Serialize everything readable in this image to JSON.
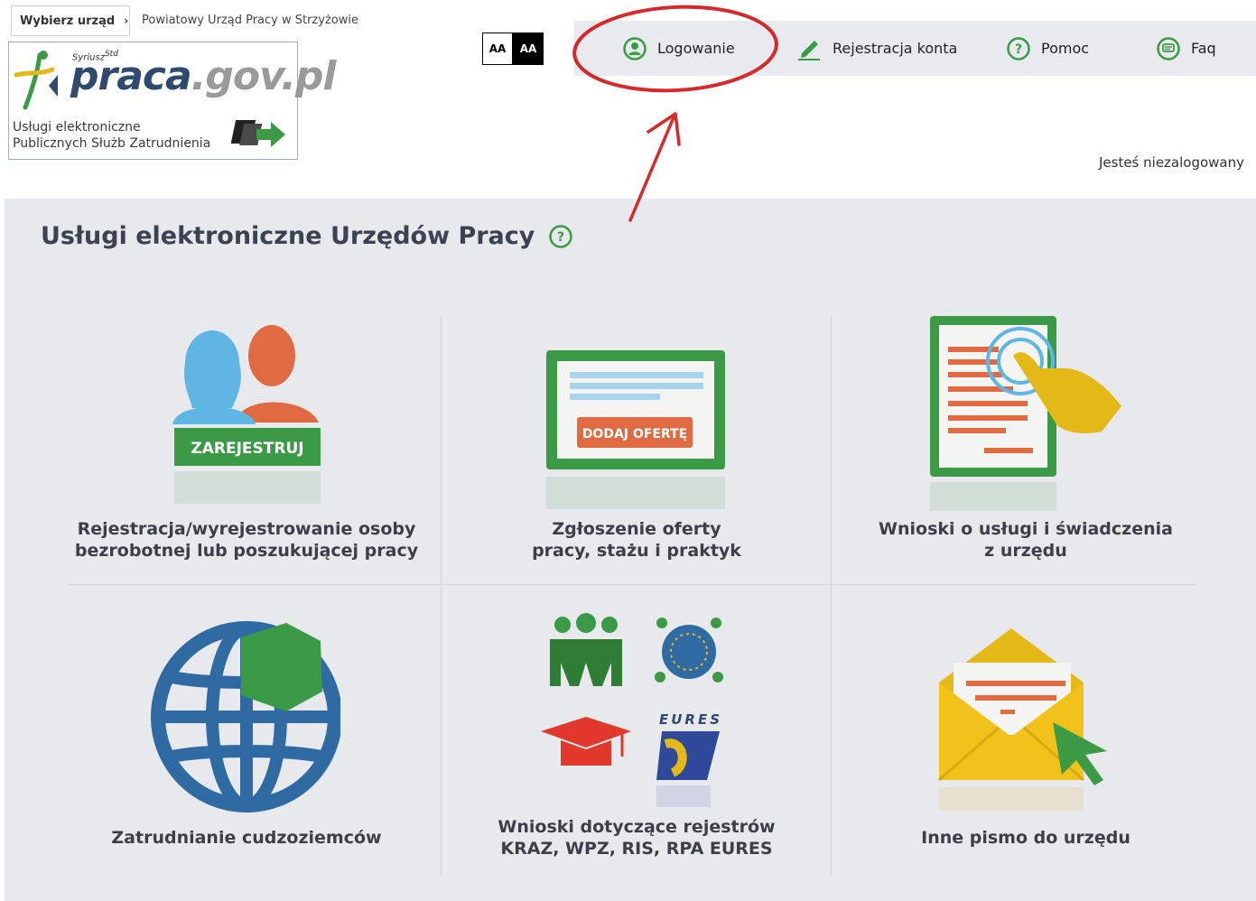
{
  "header": {
    "office_select_label": "Wybierz urząd",
    "office_name": "Powiatowy Urząd Pracy w Strzyżowie",
    "logo": {
      "prefix": "Syriusz",
      "prefix_sup": "Std",
      "brand_main": "praca",
      "brand_gov": ".gov.pl",
      "subtitle_line1": "Usługi elektroniczne",
      "subtitle_line2": "Publicznych Służb Zatrudnienia"
    },
    "font_size_small": "AA",
    "font_size_large": "AA",
    "nav": [
      {
        "label": "Logowanie",
        "icon": "user-circle-icon"
      },
      {
        "label": "Rejestracja konta",
        "icon": "pencil-icon"
      },
      {
        "label": "Pomoc",
        "icon": "question-circle-icon"
      },
      {
        "label": "Faq",
        "icon": "chat-bubble-icon"
      }
    ],
    "login_status": "Jesteś niezalogowany"
  },
  "main": {
    "title": "Usługi elektroniczne Urzędów Pracy",
    "tiles": [
      {
        "label_line1": "Rejestracja/wyrejestrowanie osoby",
        "label_line2": "bezrobotnej lub poszukującej pracy",
        "icon_text": "ZAREJESTRUJ",
        "icon": "people-register-icon"
      },
      {
        "label_line1": "Zgłoszenie oferty",
        "label_line2": "pracy, stażu i praktyk",
        "icon_text": "DODAJ OFERTĘ",
        "icon": "job-offer-icon"
      },
      {
        "label_line1": "Wnioski o usługi i świadczenia",
        "label_line2": "z urzędu",
        "icon": "document-touch-icon"
      },
      {
        "label_line1": "Zatrudnianie cudzoziemców",
        "label_line2": "",
        "icon": "globe-icon"
      },
      {
        "label_line1": "Wnioski dotyczące rejestrów",
        "label_line2": "KRAZ, WPZ, RIS, RPA EURES",
        "icon_text": "EURES",
        "icon": "registers-icon"
      },
      {
        "label_line1": "Inne pismo do urzędu",
        "label_line2": "",
        "icon": "envelope-icon"
      }
    ]
  },
  "colors": {
    "accent_green": "#3a9a45",
    "annotation_red": "#d42a2a",
    "panel_bg": "#e8e9ed",
    "nav_bg": "#e8eaed"
  }
}
